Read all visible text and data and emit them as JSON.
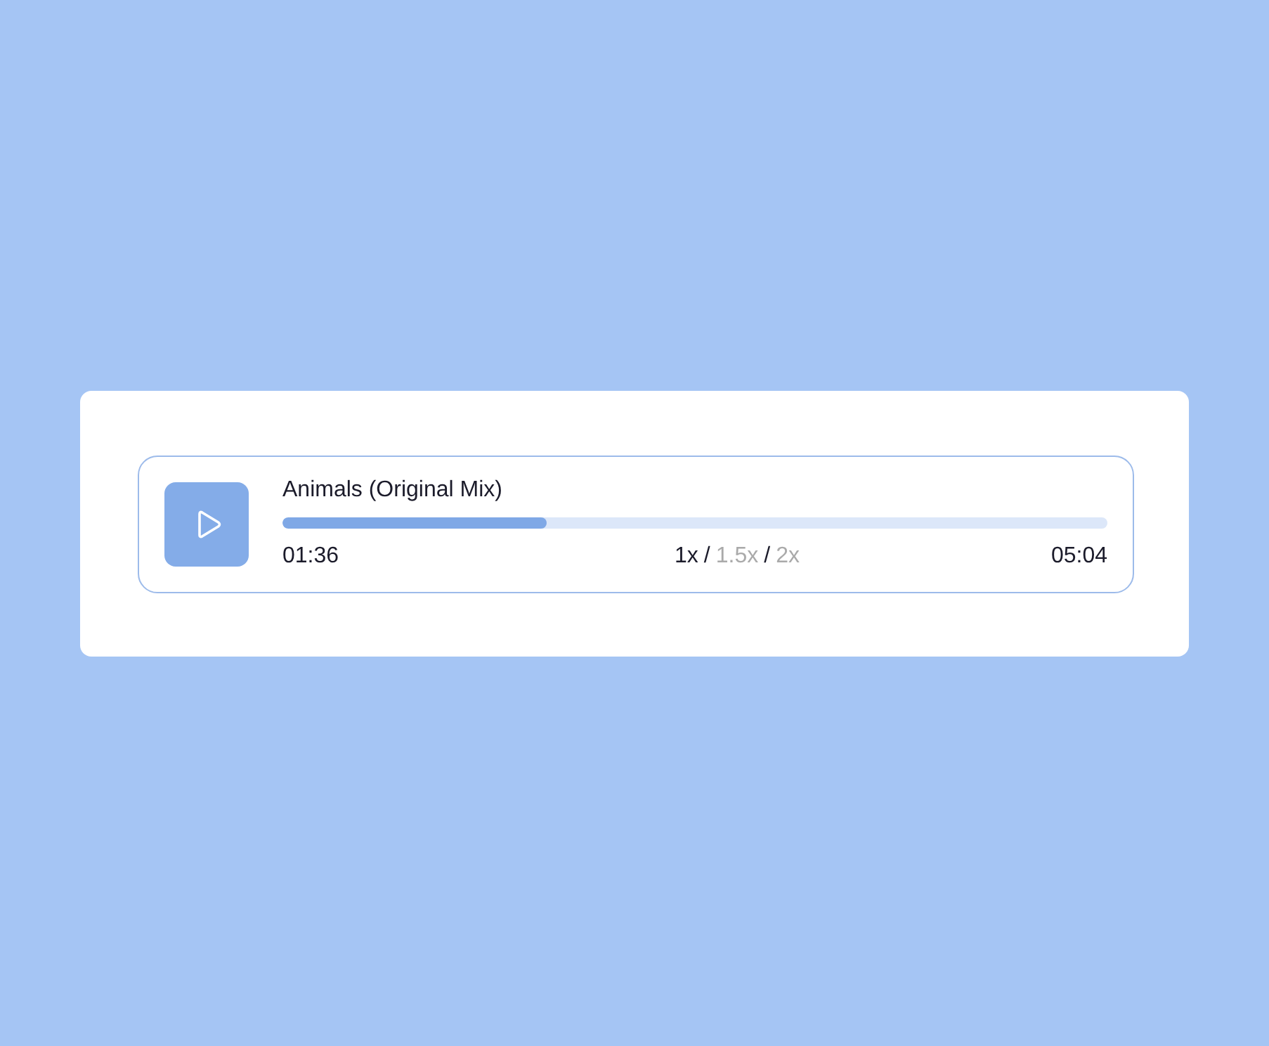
{
  "player": {
    "title": "Animals (Original Mix)",
    "level": 0.32,
    "elapsed": "01:36",
    "duration": "05:04",
    "speeds": [
      {
        "label": "1x",
        "selected": true
      },
      {
        "label": "1.5x",
        "selected": false
      },
      {
        "label": "2x",
        "selected": false
      }
    ],
    "separators": [
      "/",
      "/"
    ]
  }
}
